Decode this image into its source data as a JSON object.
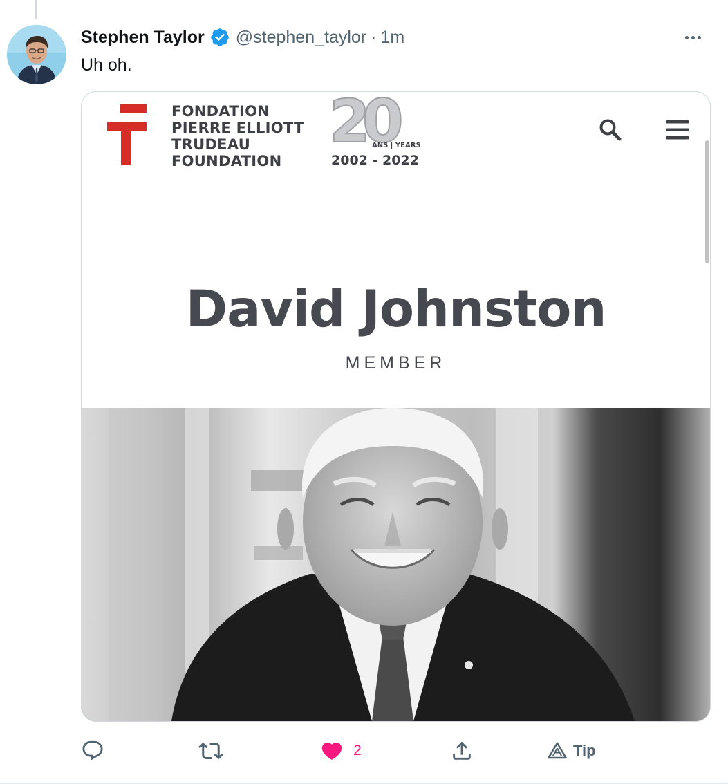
{
  "tweet": {
    "display_name": "Stephen Taylor",
    "verified": true,
    "handle": "@stephen_taylor",
    "separator": "·",
    "time": "1m",
    "text": "Uh oh.",
    "avatar_icon": "user-avatar-photo",
    "more_icon": "more-horizontal-icon"
  },
  "card": {
    "org_lines": [
      "FONDATION",
      "PIERRE ELLIOTT",
      "TRUDEAU",
      "FOUNDATION"
    ],
    "anniversary_number": "20",
    "anniversary_label": "ANS | YEARS",
    "anniversary_years": "2002 - 2022",
    "person_name": "David Johnston",
    "person_role": "MEMBER",
    "brand_red": "#d62e27",
    "text_gray": "#464a50",
    "search_icon": "search-icon",
    "menu_icon": "hamburger-menu-icon"
  },
  "actions": {
    "reply_icon": "reply-icon",
    "retweet_icon": "retweet-icon",
    "like_icon": "heart-filled-icon",
    "like_count": "2",
    "share_icon": "share-icon",
    "tip_icon": "tip-icon",
    "tip_label": "Tip",
    "like_color": "#f91880"
  }
}
